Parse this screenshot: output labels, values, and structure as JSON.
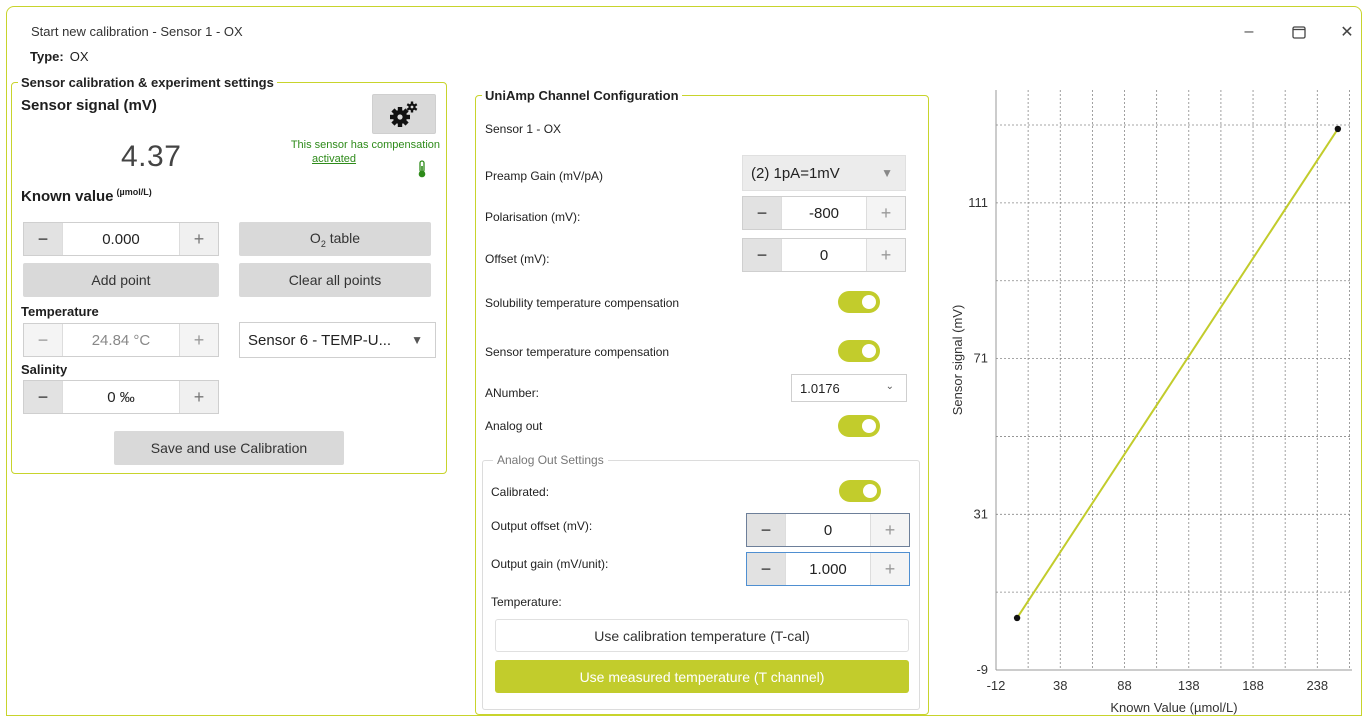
{
  "window": {
    "title": "Start new calibration - Sensor 1 - OX",
    "controls": {
      "minimize": "–",
      "maximize": "☐",
      "close": "✕"
    }
  },
  "type_line": {
    "label": "Type:",
    "value": "OX"
  },
  "left": {
    "legend": "Sensor calibration & experiment settings",
    "signal_title": "Sensor signal (mV)",
    "signal_value": "4.37",
    "compensation_text": "This sensor has compensation",
    "compensation_link": "activated",
    "known_title": "Known value",
    "known_unit": "(µmol/L)",
    "known_input": "0.000",
    "o2_table_label": "O",
    "o2_sub": "2",
    "o2_suffix": " table",
    "add_point": "Add point",
    "clear_points": "Clear all points",
    "temperature_label": "Temperature",
    "temperature_value": "24.84 °C",
    "temp_sensor_select": "Sensor 6 - TEMP-U...",
    "salinity_label": "Salinity",
    "salinity_value": "0 ‰",
    "save_button": "Save and use Calibration",
    "minus": "−",
    "plus": "+"
  },
  "mid": {
    "legend": "UniAmp Channel Configuration",
    "sensor_name": "Sensor 1 - OX",
    "preamp_label": "Preamp Gain (mV/pA)",
    "preamp_value": "(2) 1pA=1mV",
    "polarisation_label": "Polarisation (mV):",
    "polarisation_value": "-800",
    "offset_label": "Offset (mV):",
    "offset_value": "0",
    "solubility_label": "Solubility temperature compensation",
    "solubility_on": true,
    "sensor_temp_label": "Sensor temperature compensation",
    "sensor_temp_on": true,
    "anumber_label": "ANumber:",
    "anumber_value": "1.0176",
    "analog_out_label": "Analog out",
    "analog_out_on": true,
    "analog_settings": {
      "legend": "Analog Out Settings",
      "calibrated_label": "Calibrated:",
      "calibrated_on": true,
      "output_offset_label": "Output offset (mV):",
      "output_offset_value": "0",
      "output_gain_label": "Output gain (mV/unit):",
      "output_gain_value": "1.000",
      "temperature_label": "Temperature:",
      "use_cal_temp": "Use calibration temperature (T-cal)",
      "use_measured_temp": "Use measured temperature (T channel)"
    }
  },
  "colors": {
    "accent": "#c2cc2c",
    "green_text": "#2e8b1a",
    "border": "#c8d42c"
  },
  "chart_data": {
    "type": "line",
    "xlabel": "Known Value (µmol/L)",
    "ylabel": "Sensor signal (mV)",
    "xlim": [
      -12,
      265
    ],
    "ylim": [
      -9,
      140
    ],
    "x_ticks": [
      -12,
      38,
      88,
      138,
      188,
      238
    ],
    "y_ticks": [
      -9,
      31,
      71,
      111
    ],
    "grid": true,
    "series": [
      {
        "points": [
          [
            4.4,
            4.37
          ],
          [
            254,
            130
          ]
        ]
      }
    ]
  }
}
